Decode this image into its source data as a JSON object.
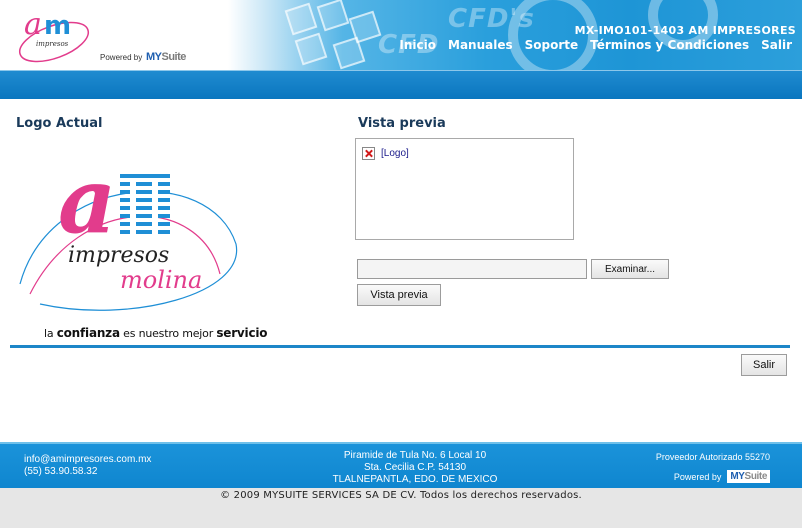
{
  "header": {
    "powered_by": "Powered by",
    "mysuite_brand": "MY",
    "mysuite_brand_suffix": "Suite",
    "account_name": "MX-IMO101-1403 AM IMPRESORES",
    "nav": [
      "Inicio",
      "Manuales",
      "Soporte",
      "Términos y Condiciones",
      "Salir"
    ]
  },
  "content": {
    "current_logo_title": "Logo Actual",
    "preview_title": "Vista previa",
    "broken_image_alt": "[Logo]",
    "logo_tagline_pre": "la ",
    "logo_tagline_bold1": "confianza",
    "logo_tagline_mid": " es nuestro mejor ",
    "logo_tagline_bold2": "servicio",
    "logo_word_impresos": "impresos",
    "logo_word_molina": "molina",
    "file_input_value": "",
    "browse_button": "Examinar...",
    "preview_button": "Vista previa",
    "exit_button": "Salir"
  },
  "footer": {
    "email": "info@amimpresores.com.mx",
    "phone": "(55) 53.90.58.32",
    "address_line1": "Piramide de Tula No. 6 Local 10",
    "address_line2": "Sta. Cecilia C.P. 54130",
    "address_line3": "TLALNEPANTLA, EDO. DE MEXICO",
    "authorized": "Proveedor Autorizado 55270",
    "powered_by": "Powered by",
    "copyright": "© 2009 MYSUITE SERVICES SA DE CV. Todos los derechos reservados."
  },
  "colors": {
    "brand_blue": "#1c86c8",
    "logo_pink": "#e23c8c",
    "logo_blue": "#1f8fd6"
  }
}
